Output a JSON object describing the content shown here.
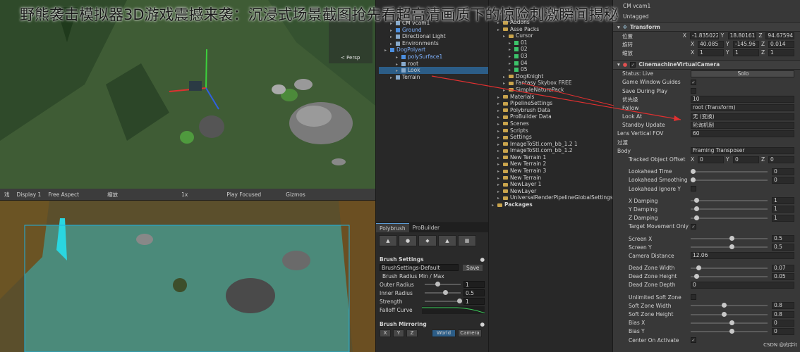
{
  "overlay_title": "野熊袭击模拟器3D游戏震撼来袭：沉浸式场景截图抢先看超高清画质下的惊险刺激瞬间揭秘",
  "scene": {
    "gizmo_label": "< Persp"
  },
  "game_bar": {
    "tab": "戏",
    "display": "Display 1",
    "aspect": "Free Aspect",
    "scale_label": "缩放",
    "scale_value": "1x",
    "play_focused": "Play Focused",
    "gizmos": "Gizmos"
  },
  "hierarchy": {
    "items": [
      {
        "label": "CM vcam1",
        "indent": 2,
        "selected": false,
        "blue": false
      },
      {
        "label": "Directional Light",
        "indent": 2,
        "selected": false,
        "blue": false
      },
      {
        "label": "Environments",
        "indent": 2,
        "selected": false,
        "blue": false
      },
      {
        "label": "DogPolyart",
        "indent": 1,
        "selected": false,
        "blue": true
      },
      {
        "label": "polySurface1",
        "indent": 3,
        "selected": false,
        "blue": true
      },
      {
        "label": "root",
        "indent": 3,
        "selected": false,
        "blue": false
      },
      {
        "label": "Look",
        "indent": 3,
        "selected": true,
        "blue": false
      },
      {
        "label": "Terrain",
        "indent": 2,
        "selected": false,
        "blue": false
      }
    ],
    "ground": "Ground"
  },
  "project": {
    "items": [
      {
        "label": "Addons",
        "indent": 1
      },
      {
        "label": "Asse Packs",
        "indent": 1
      },
      {
        "label": "Cursor",
        "indent": 2
      },
      {
        "label": "01",
        "indent": 3
      },
      {
        "label": "02",
        "indent": 3
      },
      {
        "label": "03",
        "indent": 3
      },
      {
        "label": "04",
        "indent": 3
      },
      {
        "label": "05",
        "indent": 3
      },
      {
        "label": "DogKnight",
        "indent": 2
      },
      {
        "label": "Fantasy Skybox FREE",
        "indent": 2
      },
      {
        "label": "SimpleNaturePack",
        "indent": 2
      },
      {
        "label": "Materials",
        "indent": 1
      },
      {
        "label": "PipelineSettings",
        "indent": 1
      },
      {
        "label": "Polybrush Data",
        "indent": 1
      },
      {
        "label": "ProBuilder Data",
        "indent": 1
      },
      {
        "label": "Scenes",
        "indent": 1
      },
      {
        "label": "Scripts",
        "indent": 1
      },
      {
        "label": "Settings",
        "indent": 1
      },
      {
        "label": "ImageToStl.com_bb_1.2 1",
        "indent": 1
      },
      {
        "label": "ImageToStl.com_bb_1.2",
        "indent": 1
      },
      {
        "label": "New Terrain 1",
        "indent": 1
      },
      {
        "label": "New Terrain 2",
        "indent": 1
      },
      {
        "label": "New Terrain 3",
        "indent": 1
      },
      {
        "label": "New Terrain",
        "indent": 1
      },
      {
        "label": "NewLayer 1",
        "indent": 1
      },
      {
        "label": "NewLayer",
        "indent": 1
      },
      {
        "label": "UniversalRenderPipelineGlobalSettings",
        "indent": 1
      },
      {
        "label": "Packages",
        "indent": 0
      }
    ]
  },
  "polybrush": {
    "tabs": [
      "Polybrush",
      "ProBuilder"
    ],
    "brush_settings": "Brush Settings",
    "preset": "BrushSettings-Default",
    "save": "Save",
    "radius_header": "Brush Radius Min / Max",
    "outer_radius_label": "Outer Radius",
    "outer_radius": "1",
    "inner_radius_label": "Inner Radius",
    "inner_radius": "0.5",
    "strength_label": "Strength",
    "strength": "1",
    "falloff_label": "Falloff Curve",
    "mirroring": "Brush Mirroring",
    "axes": [
      "X",
      "Y",
      "Z"
    ],
    "space_world": "World",
    "space_camera": "Camera"
  },
  "inspector": {
    "object_name": "CM vcam1",
    "tag": "Untagged",
    "transform": {
      "header": "Transform",
      "position_label": "位置",
      "rotation_label": "旋转",
      "scale_label": "缩放",
      "position": [
        "-1.835022",
        "18.80161",
        "94.67594"
      ],
      "rotation": [
        "40.085",
        "-145.96",
        "0.014"
      ],
      "scale": [
        "1",
        "1",
        "1"
      ]
    },
    "vcam": {
      "header": "CinemachineVirtualCamera",
      "status_label": "Status: Live",
      "solo": "Solo",
      "game_window_guides": "Game Window Guides",
      "save_during_play": "Save During Play",
      "priority_label": "优先级",
      "priority": "10",
      "follow_label": "Follow",
      "follow": "root (Transform)",
      "look_at_label": "Look At",
      "look_at": "无 (变换)",
      "standby_label": "Standby Update",
      "standby": "轮询机制",
      "lens_label": "Lens Vertical FOV",
      "lens": "60",
      "transition_label": "过渡",
      "body_label": "Body",
      "body": "Framing Transposer",
      "tracked_offset_label": "Tracked Object Offset",
      "tracked_offset": [
        "0",
        "0",
        "0"
      ],
      "lookahead_time_label": "Lookahead Time",
      "lookahead_time": "0",
      "lookahead_smoothing_label": "Lookahead Smoothing",
      "lookahead_smoothing": "0",
      "lookahead_ignore_y_label": "Lookahead Ignore Y",
      "x_damping_label": "X Damping",
      "x_damping": "1",
      "y_damping_label": "Y Damping",
      "y_damping": "1",
      "z_damping_label": "Z Damping",
      "z_damping": "1",
      "target_movement_only_label": "Target Movement Only",
      "screen_x_label": "Screen X",
      "screen_x": "0.5",
      "screen_y_label": "Screen Y",
      "screen_y": "0.5",
      "camera_distance_label": "Camera Distance",
      "camera_distance": "12.06",
      "dead_zone_width_label": "Dead Zone Width",
      "dead_zone_width": "0.07",
      "dead_zone_height_label": "Dead Zone Height",
      "dead_zone_height": "0.05",
      "dead_zone_depth_label": "Dead Zone Depth",
      "dead_zone_depth": "0",
      "unlimited_soft_zone_label": "Unlimited Soft Zone",
      "soft_zone_width_label": "Soft Zone Width",
      "soft_zone_width": "0.8",
      "soft_zone_height_label": "Soft Zone Height",
      "soft_zone_height": "0.8",
      "bias_x_label": "Bias X",
      "bias_x": "0",
      "bias_y_label": "Bias Y",
      "bias_y": "0",
      "center_on_activate_label": "Center On Activate"
    }
  },
  "watermark": "CSDN @向宇it"
}
